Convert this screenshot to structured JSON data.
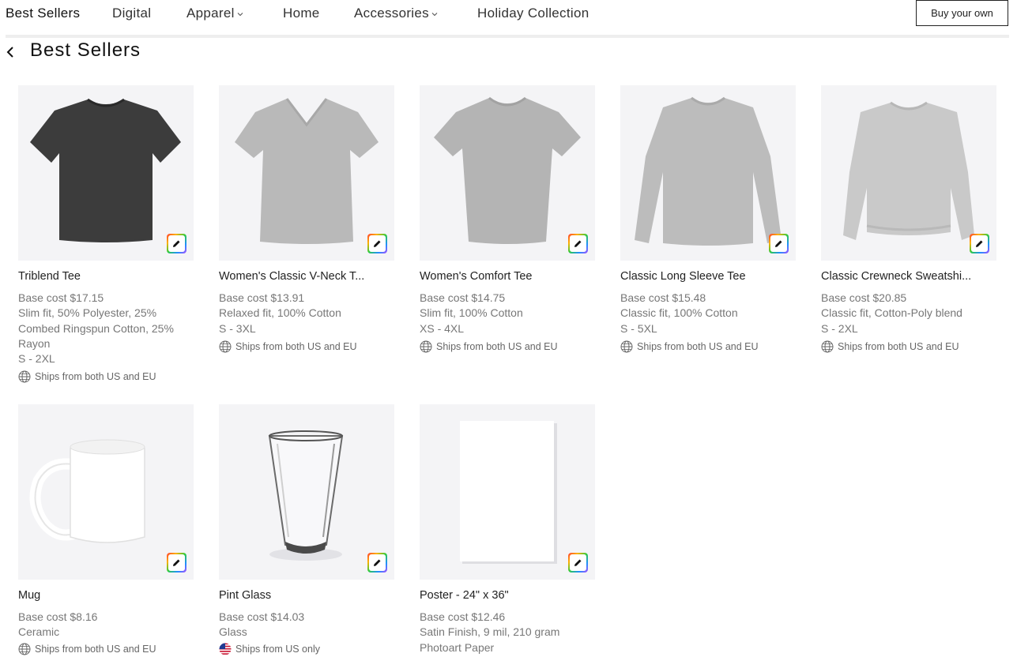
{
  "nav": {
    "items": [
      {
        "label": "Best Sellers",
        "active": true,
        "has_dropdown": false
      },
      {
        "label": "Digital",
        "active": false,
        "has_dropdown": false
      },
      {
        "label": "Apparel",
        "active": false,
        "has_dropdown": true
      },
      {
        "label": "Home",
        "active": false,
        "has_dropdown": false
      },
      {
        "label": "Accessories",
        "active": false,
        "has_dropdown": true
      },
      {
        "label": "Holiday Collection",
        "active": false,
        "has_dropdown": false
      }
    ],
    "cta_label": "Buy your own"
  },
  "page": {
    "title": "Best Sellers",
    "back_icon": "chevron-left-icon"
  },
  "products": [
    {
      "name": "Triblend Tee",
      "cost": "Base cost $17.15",
      "fit": "Slim fit, 50% Polyester, 25% Combed Ringspun Cotton, 25% Rayon",
      "sizes": "S - 2XL",
      "shipping": "Ships from both US and EU",
      "ship_icon": "globe-icon",
      "product_color": "#3c3c3c"
    },
    {
      "name": "Women's Classic V-Neck T...",
      "cost": "Base cost $13.91",
      "fit": "Relaxed fit, 100% Cotton",
      "sizes": "S - 3XL",
      "shipping": "Ships from both US and EU",
      "ship_icon": "globe-icon",
      "product_color": "#b9b9b9"
    },
    {
      "name": "Women's Comfort Tee",
      "cost": "Base cost $14.75",
      "fit": "Slim fit, 100% Cotton",
      "sizes": "XS - 4XL",
      "shipping": "Ships from both US and EU",
      "ship_icon": "globe-icon",
      "product_color": "#b4b4b4"
    },
    {
      "name": "Classic Long Sleeve Tee",
      "cost": "Base cost $15.48",
      "fit": "Classic fit, 100% Cotton",
      "sizes": "S - 5XL",
      "shipping": "Ships from both US and EU",
      "ship_icon": "globe-icon",
      "product_color": "#bcbcbc"
    },
    {
      "name": "Classic Crewneck Sweatshi...",
      "cost": "Base cost $20.85",
      "fit": "Classic fit, Cotton-Poly blend",
      "sizes": "S - 2XL",
      "shipping": "Ships from both US and EU",
      "ship_icon": "globe-icon",
      "product_color": "#c9c9c9"
    },
    {
      "name": "Mug",
      "cost": "Base cost $8.16",
      "fit": "Ceramic",
      "sizes": "",
      "shipping": "Ships from both US and EU",
      "ship_icon": "globe-icon",
      "product_color": "#ffffff"
    },
    {
      "name": "Pint Glass",
      "cost": "Base cost $14.03",
      "fit": "Glass",
      "sizes": "",
      "shipping": "Ships from US only",
      "ship_icon": "us-flag-icon",
      "product_color": "#e8e8e8"
    },
    {
      "name": "Poster - 24\" x 36\"",
      "cost": "Base cost $12.46",
      "fit": "Satin Finish, 9 mil, 210 gram Photoart Paper",
      "sizes": "",
      "shipping": "",
      "ship_icon": "",
      "product_color": "#ffffff"
    }
  ],
  "edit_icon": "pencil-icon"
}
